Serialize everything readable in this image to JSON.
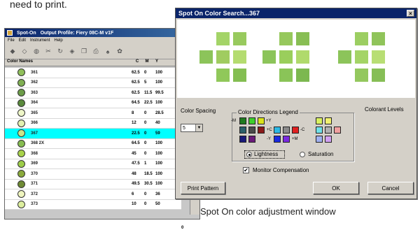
{
  "page": {
    "top_text": "need to print.",
    "caption": "Spot On color adjustment window"
  },
  "back_window": {
    "title_app": "Spot-On",
    "title_profile": "Output Profile: Fiery 08C-M v1F",
    "menu": [
      "File",
      "Edit",
      "Instrument",
      "Help"
    ],
    "toolbar_icons": [
      "eraser-icon",
      "eraser2-icon",
      "paint-icon",
      "scissors-icon",
      "rotate-icon",
      "eraser3-icon",
      "copy-icon",
      "printer-icon",
      "bucket-icon",
      "palette-icon"
    ],
    "columns": [
      "Color Names",
      "C",
      "M",
      "Y"
    ],
    "rows": [
      {
        "name": "361",
        "c": "62.5",
        "m": "0",
        "y": "100",
        "color": "#8fbe5a",
        "selected": false
      },
      {
        "name": "362",
        "c": "62.5",
        "m": "5",
        "y": "100",
        "color": "#7fae52",
        "selected": false
      },
      {
        "name": "363",
        "c": "62.5",
        "m": "11.5",
        "y": "99.5",
        "color": "#6c9c48",
        "selected": false
      },
      {
        "name": "364",
        "c": "64.5",
        "m": "22.5",
        "y": "100",
        "color": "#5a8a3c",
        "selected": false
      },
      {
        "name": "365",
        "c": "8",
        "m": "0",
        "y": "28.5",
        "color": "#eef6c8",
        "selected": false
      },
      {
        "name": "366",
        "c": "12",
        "m": "0",
        "y": "40",
        "color": "#e2f0b0",
        "selected": false
      },
      {
        "name": "367",
        "c": "22.5",
        "m": "0",
        "y": "59",
        "color": "#c8e48a",
        "selected": true
      },
      {
        "name": "368 2X",
        "c": "64.5",
        "m": "0",
        "y": "100",
        "color": "#86bc50",
        "selected": false
      },
      {
        "name": "368",
        "c": "45",
        "m": "0",
        "y": "100",
        "color": "#a8d24a",
        "selected": false
      },
      {
        "name": "369",
        "c": "47.5",
        "m": "1",
        "y": "100",
        "color": "#9ccc48",
        "selected": false
      },
      {
        "name": "370",
        "c": "48",
        "m": "18.5",
        "y": "100",
        "color": "#8aaa3c",
        "selected": false
      },
      {
        "name": "371",
        "c": "49.5",
        "m": "30.5",
        "y": "100",
        "color": "#6e8a34",
        "selected": false
      },
      {
        "name": "372",
        "c": "6",
        "m": "0",
        "y": "36",
        "color": "#eef4be",
        "selected": false
      },
      {
        "name": "373",
        "c": "10",
        "m": "0",
        "y": "50",
        "color": "#dcee9e",
        "selected": false
      }
    ],
    "extra_value": "0"
  },
  "dialog": {
    "title": "Spot On Color Search...367",
    "close_label": "×",
    "color_spacing_label": "Color Spacing",
    "color_spacing_value": "5",
    "color_directions_label": "Color Directions Legend",
    "colorant_levels_label": "Colorant Levels",
    "dir_labels": {
      "m": "-M",
      "plus_y": "+Y",
      "plus_c": "+C",
      "minus_c": "-C",
      "minus_y": "-Y",
      "plus_m": "+M"
    },
    "lightness_label": "Lightness",
    "saturation_label": "Saturation",
    "lightness_selected": true,
    "monitor_compensation_label": "Monitor Compensation",
    "monitor_compensation_checked": true,
    "check_mark": "✔",
    "print_pattern_label": "Print Pattern",
    "ok_label": "OK",
    "cancel_label": "Cancel",
    "clusters": [
      {
        "center": "#8cc45a",
        "shades": [
          "#a4d468",
          "#98ca5e",
          "#8cc45a",
          "#a0cc60",
          "#b4dc70",
          "#90c85a",
          "#84be52"
        ]
      },
      {
        "center": "#8cc45a",
        "shades": [
          "#96c85c",
          "#88be54",
          "#8cc45a",
          "#9ace5c",
          "#b0da6c",
          "#8ac458",
          "#7cb850"
        ]
      },
      {
        "center": "#8cc45a",
        "shades": [
          "#9cce62",
          "#90c45a",
          "#8cc45a",
          "#a4d466",
          "#b8de74",
          "#94c85e",
          "#86be56"
        ]
      }
    ]
  }
}
